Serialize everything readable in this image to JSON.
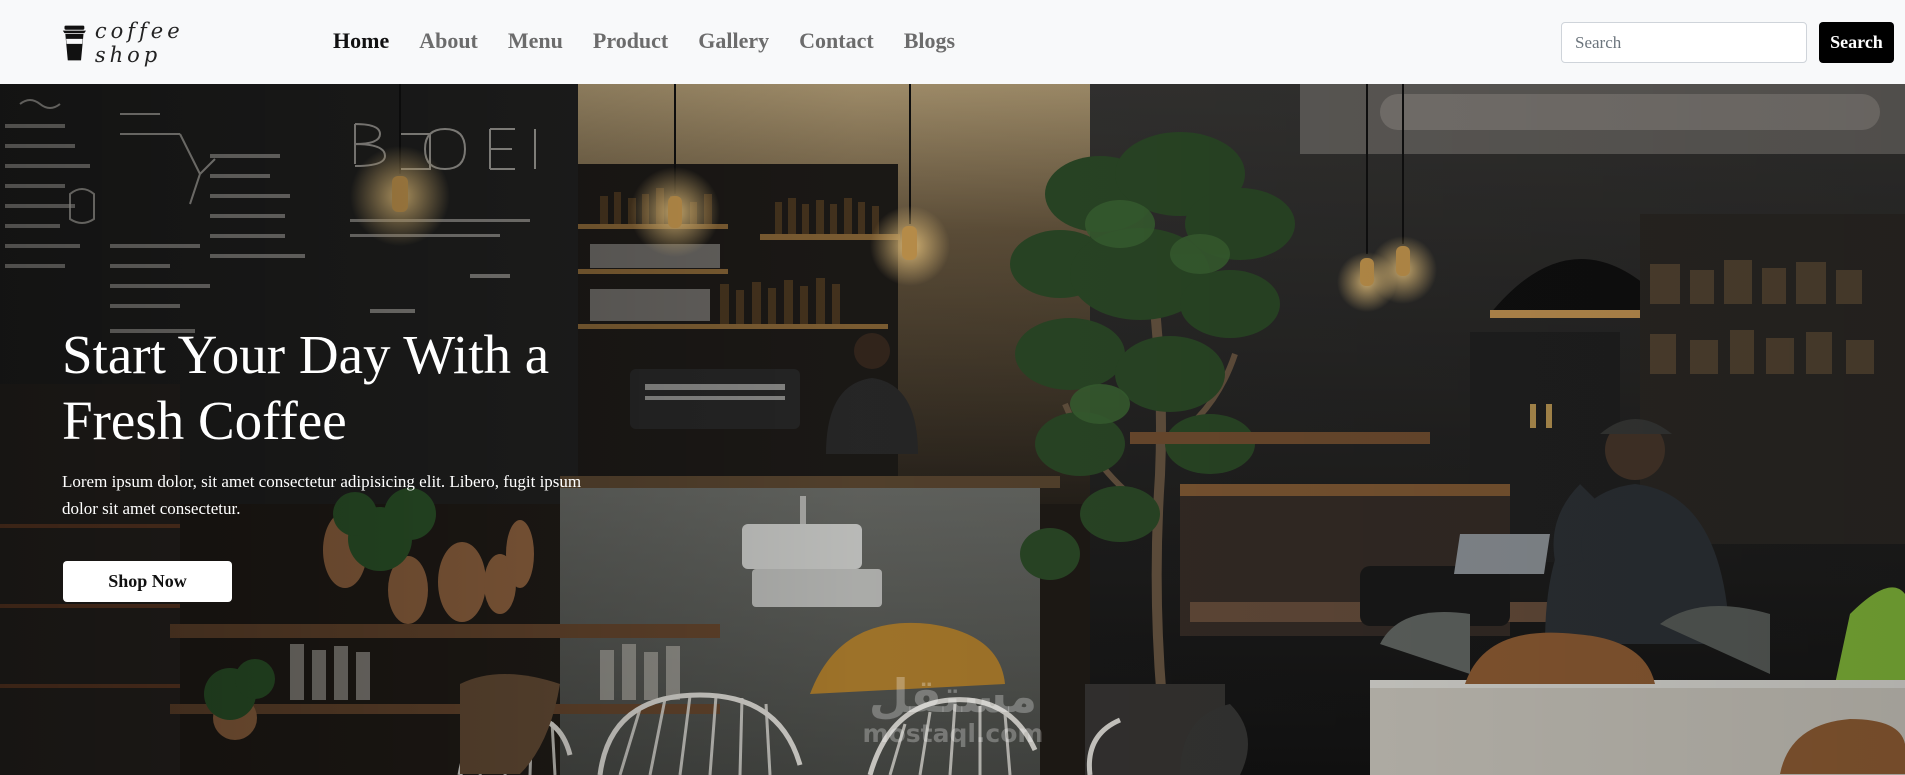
{
  "brand": {
    "logo_text": "coffee shop"
  },
  "nav": {
    "items": [
      {
        "label": "Home",
        "active": true
      },
      {
        "label": "About"
      },
      {
        "label": "Menu"
      },
      {
        "label": "Product"
      },
      {
        "label": "Gallery"
      },
      {
        "label": "Contact"
      },
      {
        "label": "Blogs"
      }
    ]
  },
  "search": {
    "placeholder": "Search",
    "value": "",
    "button_label": "Search"
  },
  "hero": {
    "title": "Start Your Day With a Fresh Coffee",
    "text": "Lorem ipsum dolor, sit amet consectetur adipisicing elit. Libero, fugit ipsum dolor sit amet consectetur.",
    "button_label": "Shop Now"
  },
  "watermark": {
    "arabic": "مستقل",
    "latin": "mostaql.com"
  },
  "colors": {
    "navbar_bg": "#f8f9fa",
    "nav_active": "#111111",
    "nav_inactive": "#6c6c6c",
    "search_button_bg": "#000000",
    "hero_text": "#ffffff"
  }
}
